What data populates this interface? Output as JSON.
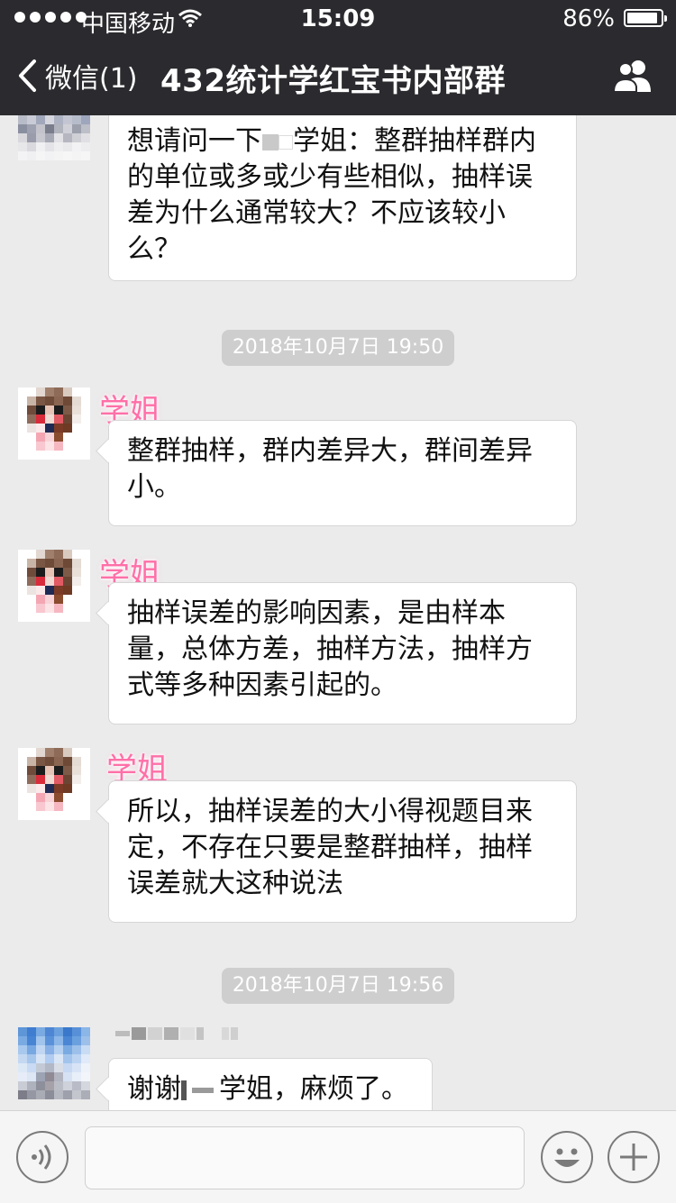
{
  "status_bar": {
    "carrier": "中国移动",
    "time": "15:09",
    "battery": "86%",
    "battery_level": 0.86
  },
  "nav": {
    "back_label": "微信(1)",
    "title": "432统计学红宝书内部群"
  },
  "messages": [
    {
      "type": "text",
      "sender": "",
      "text": "想请问一下",
      "text_after": "学姐：整群抽样群内的单位或多或少有些相似，抽样误差为什么通常较大？不应该较小么？"
    },
    {
      "type": "time",
      "text": "2018年10月7日 19:50"
    },
    {
      "type": "text",
      "sender": "学姐",
      "text": "整群抽样，群内差异大，群间差异小。"
    },
    {
      "type": "text",
      "sender": "学姐",
      "text": "抽样误差的影响因素，是由样本量，总体方差，抽样方法，抽样方式等多种因素引起的。"
    },
    {
      "type": "text",
      "sender": "学姐",
      "text": "所以，抽样误差的大小得视题目来定，不存在只要是整群抽样，抽样误差就大这种说法"
    },
    {
      "type": "time",
      "text": "2018年10月7日 19:56"
    },
    {
      "type": "text",
      "sender": "",
      "text": "谢谢",
      "text_after": "学姐，麻烦了。"
    }
  ],
  "colors": {
    "nav_bg": "#2b2b2f",
    "chat_bg": "#ebebeb",
    "sender_name": "#ff6fa8",
    "timestamp_bg": "#cecece"
  },
  "icons": {
    "back": "chevron-left-icon",
    "group": "people-icon",
    "voice": "voice-icon",
    "emoji": "smiley-icon",
    "more": "plus-icon"
  }
}
